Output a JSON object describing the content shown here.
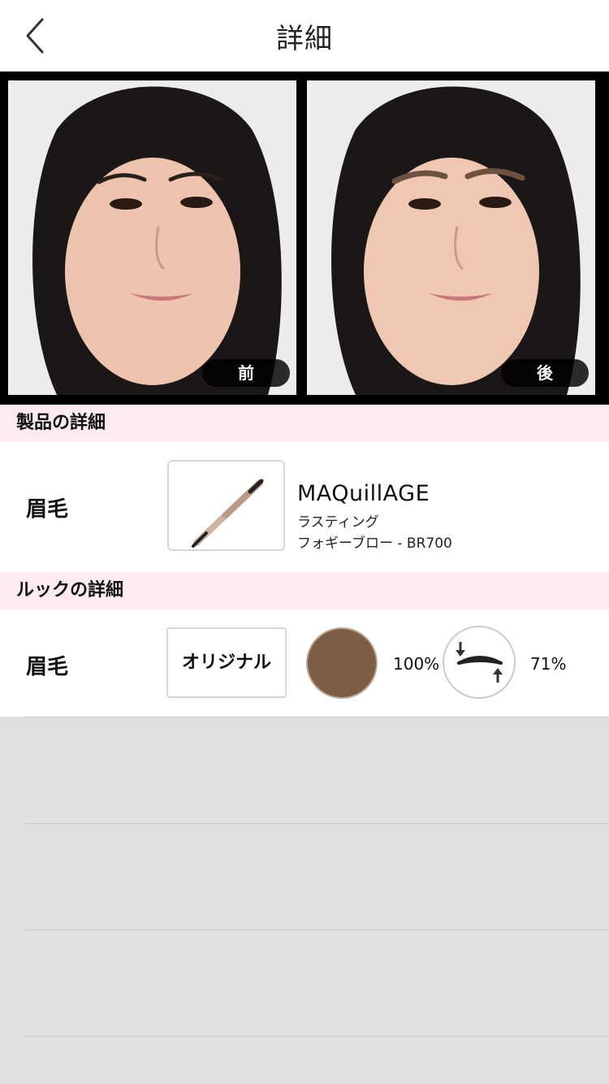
{
  "header": {
    "title": "詳細",
    "back_icon": "chevron-left-icon"
  },
  "photos": {
    "before_label": "前",
    "after_label": "後"
  },
  "product_section": {
    "title": "製品の詳細",
    "row": {
      "label": "眉毛",
      "brand": "MAQuillAGE",
      "line1": "ラスティング",
      "line2": "フォギーブロー - BR700"
    }
  },
  "look_section": {
    "title": "ルックの詳細",
    "row": {
      "label": "眉毛",
      "style_button": "オリジナル",
      "color_hex": "#7d5e44",
      "color_percent": "100%",
      "shape_percent": "71%"
    }
  }
}
